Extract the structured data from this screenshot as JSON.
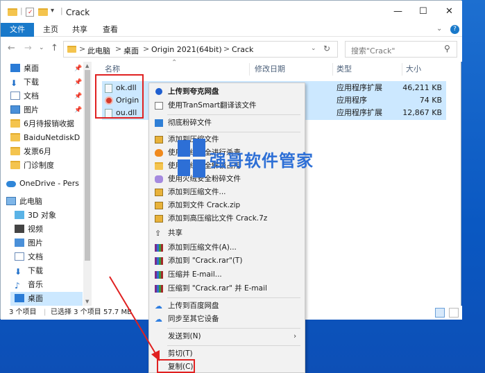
{
  "window": {
    "title": "Crack",
    "minimize_icon": "minimize-icon",
    "maximize_icon": "maximize-icon",
    "close_icon": "close-icon"
  },
  "ribbon": {
    "tabs": [
      "文件",
      "主页",
      "共享",
      "查看"
    ]
  },
  "address_bar": {
    "segments": [
      "此电脑",
      "桌面",
      "Origin 2021(64bit)",
      "Crack"
    ],
    "separator": ">"
  },
  "search": {
    "placeholder": "搜索\"Crack\""
  },
  "nav": {
    "quick_access": [
      {
        "label": "桌面",
        "pinned": true
      },
      {
        "label": "下载",
        "pinned": true
      },
      {
        "label": "文档",
        "pinned": true
      },
      {
        "label": "图片",
        "pinned": true
      },
      {
        "label": "6月待报销收据"
      },
      {
        "label": "BaiduNetdiskD"
      },
      {
        "label": "发票6月"
      },
      {
        "label": "门诊制度"
      }
    ],
    "onedrive": "OneDrive - Pers",
    "this_pc": "此电脑",
    "pc_items": [
      "3D 对象",
      "视频",
      "图片",
      "文档",
      "下载",
      "音乐",
      "桌面"
    ]
  },
  "columns": {
    "name": "名称",
    "date": "修改日期",
    "type": "类型",
    "size": "大小"
  },
  "files": [
    {
      "name": "ok.dll",
      "type": "应用程序扩展",
      "size": "46,211 KB"
    },
    {
      "name": "Origin",
      "type": "应用程序",
      "size": "74 KB"
    },
    {
      "name": "ou.dll",
      "type": "应用程序扩展",
      "size": "12,867 KB"
    }
  ],
  "status": {
    "count": "3 个项目",
    "selected": "已选择 3 个项目",
    "size": "57.7 MB"
  },
  "context_menu": {
    "items": [
      {
        "label": "上传到夸克网盘",
        "bold": true
      },
      {
        "label": "使用TranSmart翻译该文件"
      },
      {
        "label": "彻底粉碎文件"
      },
      {
        "label": "添加到压缩文件"
      },
      {
        "label": "使用火绒安全进行杀毒"
      },
      {
        "label": "使用火绒安全解锁占用"
      },
      {
        "label": "使用火绒安全粉碎文件"
      },
      {
        "label": "添加到压缩文件..."
      },
      {
        "label": "添加到文件 Crack.zip"
      },
      {
        "label": "添加到高压缩比文件 Crack.7z"
      },
      {
        "label": "共享"
      },
      {
        "label": "添加到压缩文件(A)..."
      },
      {
        "label": "添加到 \"Crack.rar\"(T)"
      },
      {
        "label": "压缩并 E-mail..."
      },
      {
        "label": "压缩到 \"Crack.rar\" 并 E-mail"
      },
      {
        "label": "上传到百度网盘"
      },
      {
        "label": "同步至其它设备"
      },
      {
        "label": "发送到(N)"
      },
      {
        "label": "剪切(T)"
      },
      {
        "label": "复制(C)"
      }
    ]
  },
  "watermark": "强哥软件管家",
  "colors": {
    "accent": "#1979ca",
    "selection": "#cce8ff",
    "highlight_box": "#e02020",
    "desktop": "#0a58c2"
  }
}
